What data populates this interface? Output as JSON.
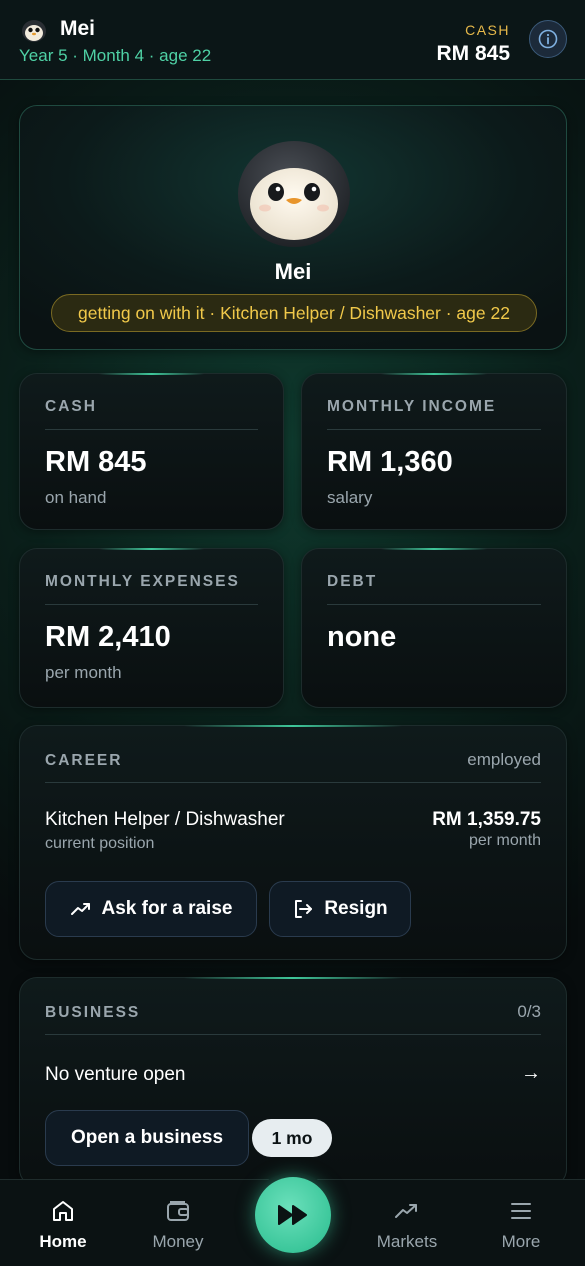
{
  "header": {
    "player_name": "Mei",
    "subtitle": "Year 5 · Month 4 · age 22",
    "cash_label": "CASH",
    "cash_value": "RM 845",
    "info_icon": "info-icon"
  },
  "profile": {
    "avatar_icon": "penguin-avatar-icon",
    "name": "Mei",
    "status": "getting on with it · Kitchen Helper / Dishwasher · age 22"
  },
  "stats": {
    "cash": {
      "label": "CASH",
      "value": "RM 845",
      "sub": "on hand"
    },
    "income": {
      "label": "MONTHLY INCOME",
      "value": "RM 1,360",
      "sub": "salary"
    },
    "expenses": {
      "label": "MONTHLY EXPENSES",
      "value": "RM 2,410",
      "sub": "per month"
    },
    "debt": {
      "label": "DEBT",
      "value": "none"
    }
  },
  "career": {
    "label": "CAREER",
    "status": "employed",
    "job_title": "Kitchen Helper / Dishwasher",
    "job_sub": "current position",
    "pay": "RM 1,359.75",
    "pay_sub": "per month",
    "raise_label": "Ask for a raise",
    "resign_label": "Resign"
  },
  "business": {
    "label": "BUSINESS",
    "count": "0/3",
    "empty_text": "No venture open",
    "arrow": "→",
    "open_label": "Open a business",
    "duration_pill": "1 mo"
  },
  "nav": {
    "home": "Home",
    "money": "Money",
    "markets": "Markets",
    "more": "More",
    "active": "home"
  },
  "colors": {
    "accent": "#3cc79b",
    "cash_label": "#e6b84a",
    "subtitle": "#4fd1a5",
    "badge_text": "#f1c94a"
  }
}
